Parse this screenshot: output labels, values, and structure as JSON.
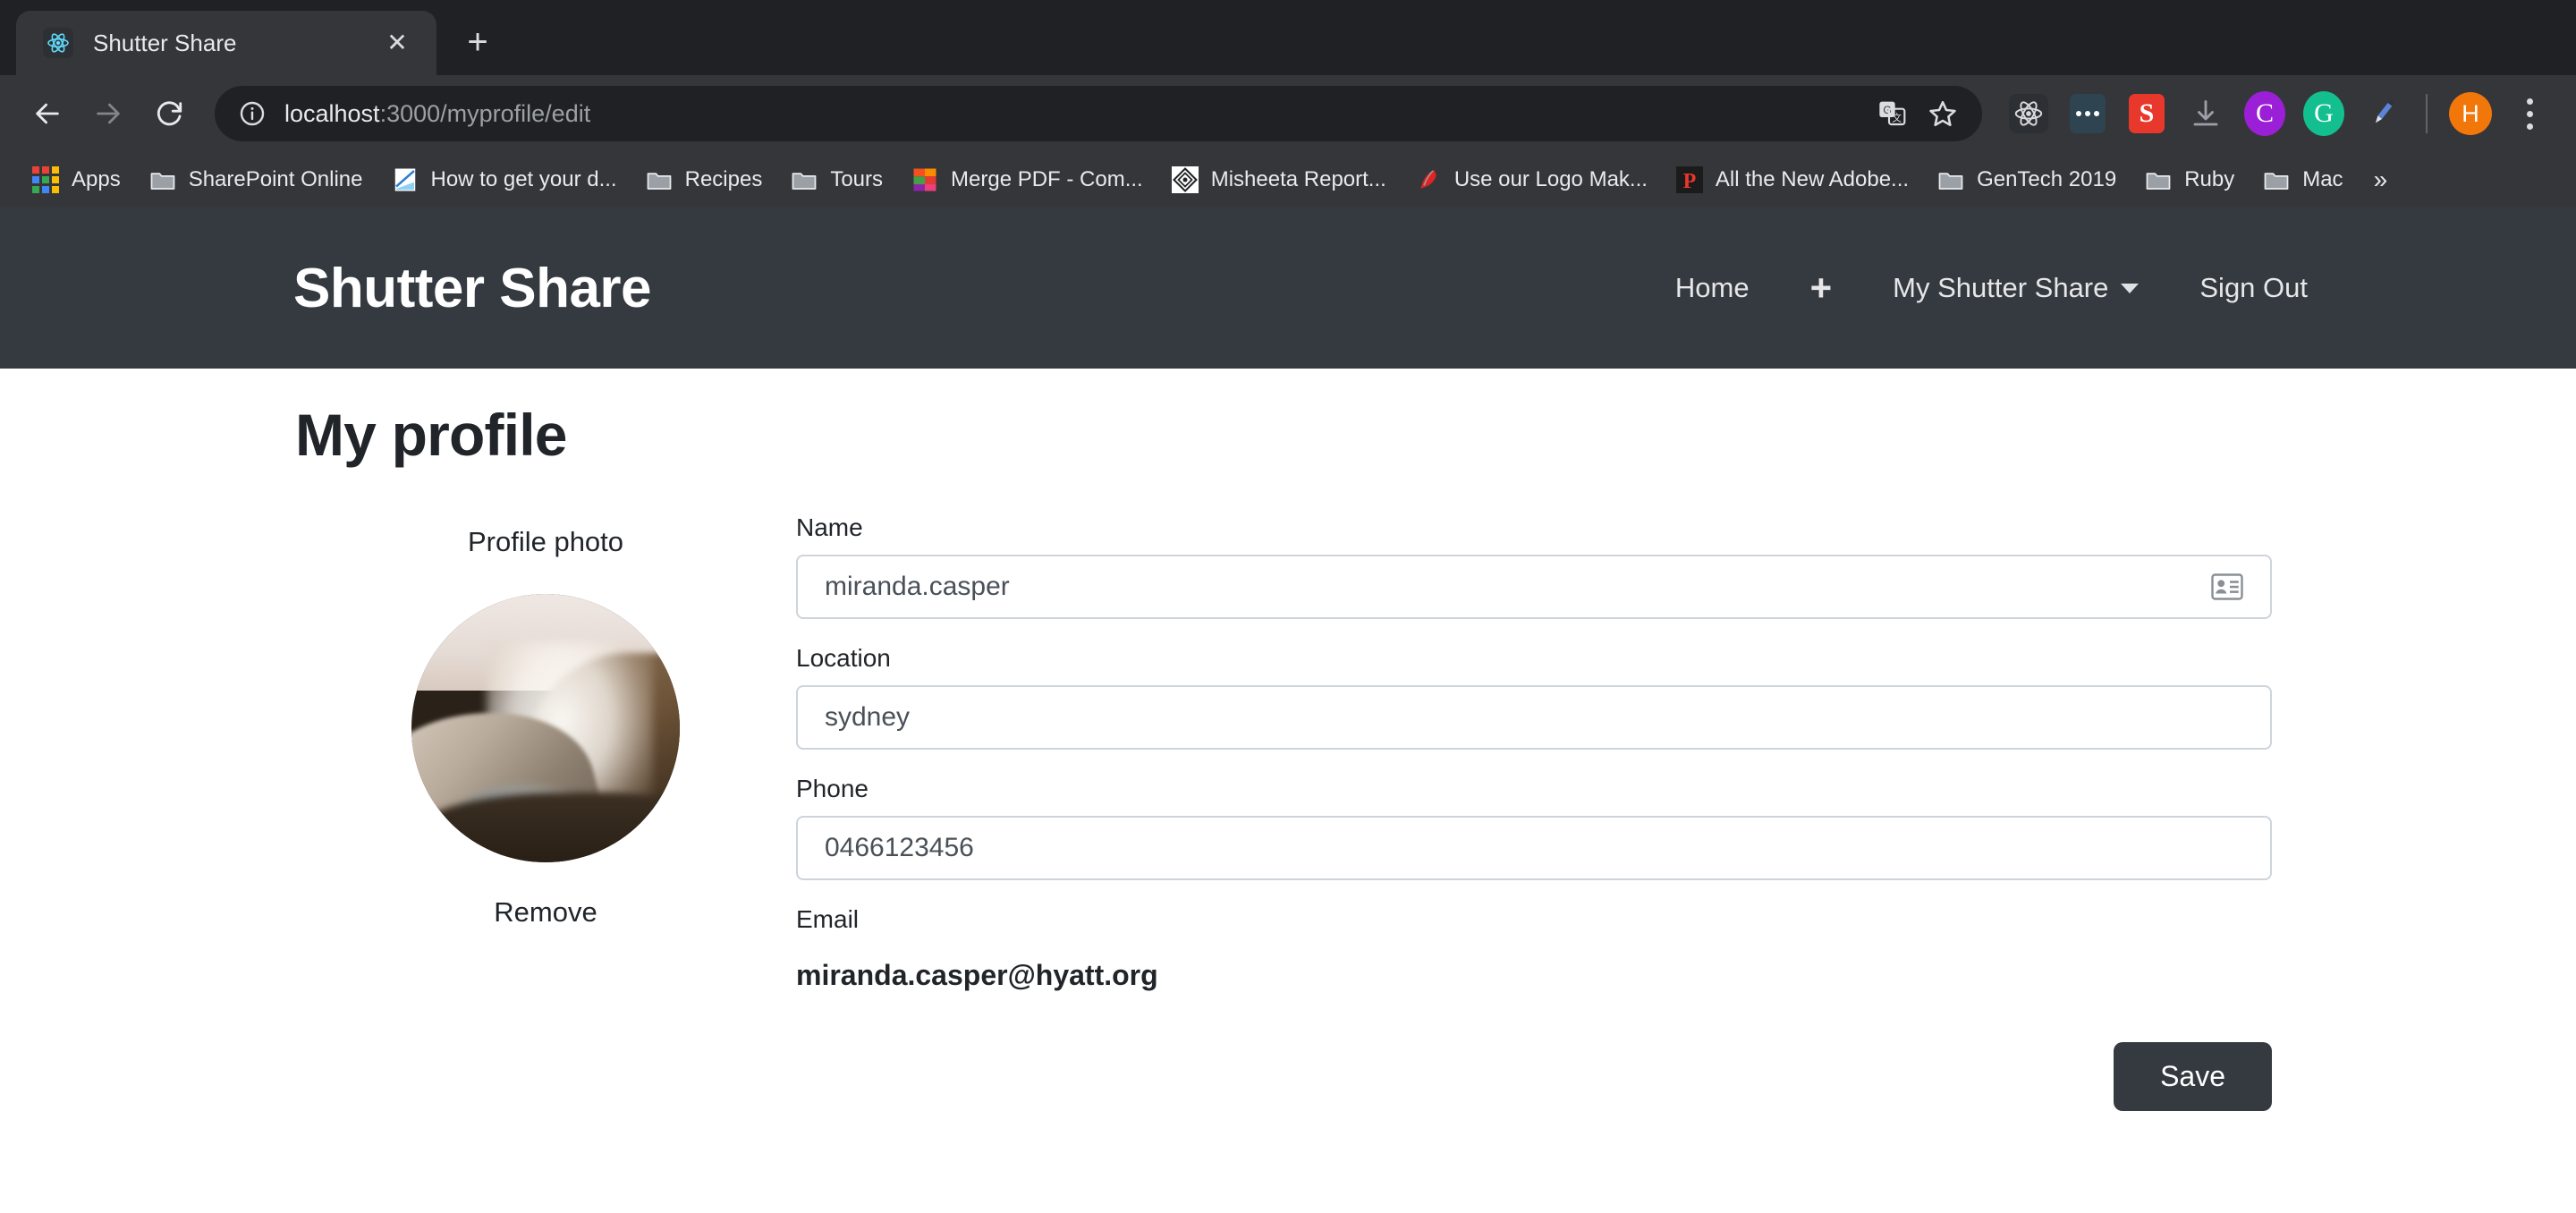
{
  "browser": {
    "tab": {
      "title": "Shutter Share",
      "favicon": "react-logo-icon",
      "close_icon": "close-icon"
    },
    "new_tab_icon": "plus-icon",
    "nav": {
      "back_icon": "back-arrow-icon",
      "forward_icon": "forward-arrow-icon",
      "reload_icon": "reload-icon"
    },
    "omnibox": {
      "info_icon": "site-info-icon",
      "host": "localhost",
      "path": ":3000/myprofile/edit",
      "url": "localhost:3000/myprofile/edit"
    },
    "toolbar_icons": [
      {
        "name": "translate-icon",
        "label": "G",
        "color": "#dadce0"
      },
      {
        "name": "bookmark-star-icon",
        "label": "",
        "color": "#dadce0"
      },
      {
        "name": "react-devtools-icon",
        "label": "",
        "color": "#61dafb"
      },
      {
        "name": "ellipsis-extension-icon",
        "label": "",
        "color": "#2e4450"
      },
      {
        "name": "s-extension-icon",
        "label": "S",
        "color": "#e8382c"
      },
      {
        "name": "download-icon",
        "label": "",
        "color": "#9aa0a6"
      },
      {
        "name": "c-extension-icon",
        "label": "C",
        "color": "#9b1fd6"
      },
      {
        "name": "g-extension-icon",
        "label": "G",
        "color": "#13bf8e"
      },
      {
        "name": "pen-extension-icon",
        "label": "",
        "color": "#3f6fd1"
      }
    ],
    "profile_avatar": {
      "name": "profile-avatar",
      "initial": "H",
      "color": "#f2770a"
    },
    "menu_icon": "kebab-menu-icon",
    "bookmarks": [
      {
        "label": "Apps",
        "icon": "apps-grid-icon"
      },
      {
        "label": "SharePoint Online",
        "icon": "folder-icon"
      },
      {
        "label": "How to get your d...",
        "icon": "site-icon"
      },
      {
        "label": "Recipes",
        "icon": "folder-icon"
      },
      {
        "label": "Tours",
        "icon": "folder-icon"
      },
      {
        "label": "Merge PDF - Com...",
        "icon": "color-squares-icon"
      },
      {
        "label": "Misheeta Report...",
        "icon": "diamond-icon"
      },
      {
        "label": "Use our Logo Mak...",
        "icon": "red-feather-icon"
      },
      {
        "label": "All the New Adobe...",
        "icon": "adobe-p-icon"
      },
      {
        "label": "GenTech 2019",
        "icon": "folder-icon"
      },
      {
        "label": "Ruby",
        "icon": "folder-icon"
      },
      {
        "label": "Mac",
        "icon": "folder-icon"
      }
    ],
    "bookmarks_overflow": "»"
  },
  "app": {
    "brand": "Shutter Share",
    "nav_links": [
      {
        "label": "Home",
        "name": "nav-home"
      },
      {
        "label": "+",
        "name": "nav-add"
      },
      {
        "label": "My Shutter Share",
        "name": "nav-my-shutter-share",
        "has_caret": true
      },
      {
        "label": "Sign Out",
        "name": "nav-sign-out"
      }
    ],
    "page_title": "My profile",
    "photo": {
      "label": "Profile photo",
      "remove_label": "Remove",
      "alt": "waterfall mist landscape"
    },
    "form": {
      "name": {
        "label": "Name",
        "value": "miranda.casper",
        "placeholder": ""
      },
      "location": {
        "label": "Location",
        "value": "sydney",
        "placeholder": ""
      },
      "phone": {
        "label": "Phone",
        "value": "0466123456",
        "placeholder": ""
      },
      "email": {
        "label": "Email",
        "value": "miranda.casper@hyatt.org"
      }
    },
    "save_label": "Save",
    "colors": {
      "navbar": "#343a40",
      "button": "#343a40",
      "border": "#ced4da"
    }
  }
}
